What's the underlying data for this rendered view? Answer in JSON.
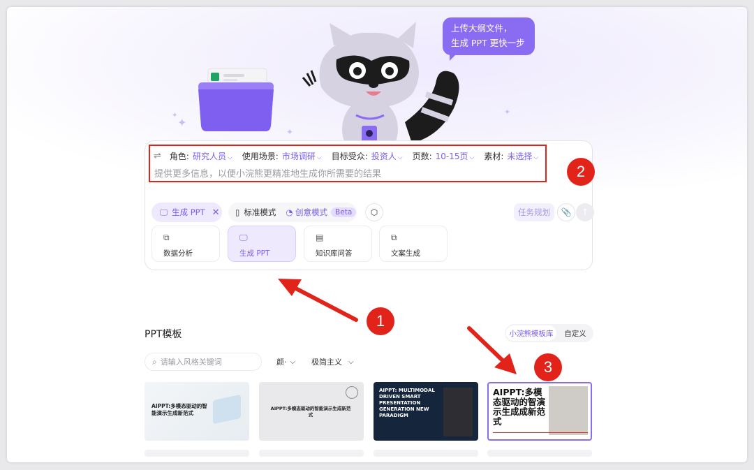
{
  "hero": {
    "speech_text_1": "上传大纲文件，",
    "speech_text_2": "生成 PPT 更快一步"
  },
  "params": [
    {
      "label": "角色:",
      "value": "研究人员"
    },
    {
      "label": "使用场景:",
      "value": "市场调研"
    },
    {
      "label": "目标受众:",
      "value": "投资人"
    },
    {
      "label": "页数:",
      "value": "10-15页"
    },
    {
      "label": "素材:",
      "value": "未选择"
    }
  ],
  "prompt_placeholder": "提供更多信息，以便小浣熊更精准地生成你所需要的结果",
  "toolbar": {
    "ppt_chip": "生成 PPT",
    "standard_mode": "标准模式",
    "creative_mode": "创意模式",
    "beta": "Beta",
    "task_plan": "任务规划"
  },
  "tiles": [
    {
      "label": "数据分析",
      "icon": "data-analysis-icon",
      "active": false
    },
    {
      "label": "生成 PPT",
      "icon": "ppt-icon",
      "active": true
    },
    {
      "label": "知识库问答",
      "icon": "knowledge-icon",
      "active": false
    },
    {
      "label": "文案生成",
      "icon": "copywriting-icon",
      "active": false
    }
  ],
  "templates": {
    "title": "PPT模板",
    "segment_library": "小浣熊模板库",
    "segment_custom": "自定义",
    "search_placeholder": "请输入风格关键词",
    "filter_color": "颜·",
    "filter_style": "极简主义",
    "cards": [
      {
        "title": "AIPPT:多模态驱动的智能演示生成新范式"
      },
      {
        "title": "AIPPT:多模态驱动的智能演示生成新范式"
      },
      {
        "title": "AIPPT: MULTIMODAL DRIVEN SMART PRESENTATION GENERATION NEW PARADIGM"
      },
      {
        "title": "AIPPT:多模态驱动的智演示生成成新范式"
      }
    ]
  },
  "annotations": [
    "1",
    "2",
    "3"
  ],
  "colors": {
    "accent": "#7b5df0",
    "annotation": "#e2231a"
  }
}
